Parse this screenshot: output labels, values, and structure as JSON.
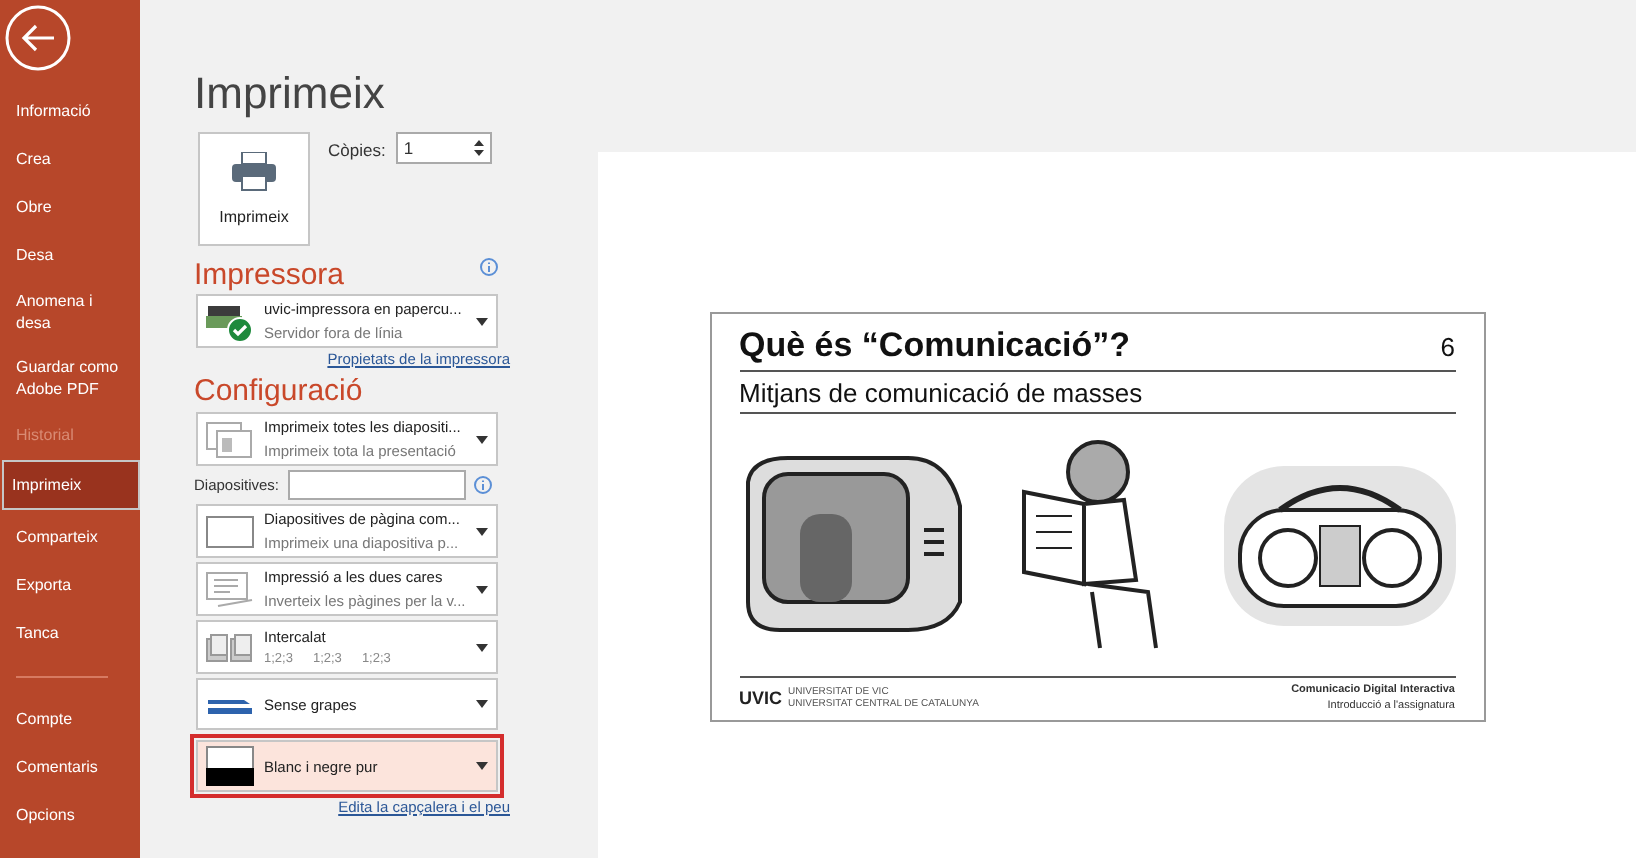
{
  "sidebar": {
    "items": [
      {
        "label": "Informació",
        "selected": false,
        "disabled": false
      },
      {
        "label": "Crea",
        "selected": false,
        "disabled": false
      },
      {
        "label": "Obre",
        "selected": false,
        "disabled": false
      },
      {
        "label": "Desa",
        "selected": false,
        "disabled": false
      },
      {
        "label": "Anomena i desa",
        "selected": false,
        "disabled": false
      },
      {
        "label": "Guardar como Adobe PDF",
        "selected": false,
        "disabled": false
      },
      {
        "label": "Historial",
        "selected": false,
        "disabled": true
      },
      {
        "label": "Imprimeix",
        "selected": true,
        "disabled": false
      },
      {
        "label": "Comparteix",
        "selected": false,
        "disabled": false
      },
      {
        "label": "Exporta",
        "selected": false,
        "disabled": false
      },
      {
        "label": "Tanca",
        "selected": false,
        "disabled": false
      }
    ],
    "footer_items": [
      {
        "label": "Compte"
      },
      {
        "label": "Comentaris"
      },
      {
        "label": "Opcions"
      }
    ]
  },
  "heading": "Imprimeix",
  "print_button": "Imprimeix",
  "copies": {
    "label": "Còpies:",
    "value": "1"
  },
  "printer": {
    "heading": "Impressora",
    "name": "uvic-impressora en papercu...",
    "status": "Servidor fora de línia",
    "link": "Propietats de la impressora"
  },
  "settings": {
    "heading": "Configuració",
    "items": [
      {
        "kind": "slides",
        "title": "Imprimeix totes les diapositi...",
        "subtitle": "Imprimeix tota la presentació",
        "highlighted": false
      },
      {
        "kind": "field",
        "label": "Diapositives:",
        "value": ""
      },
      {
        "kind": "layout",
        "title": "Diapositives de pàgina com...",
        "subtitle": "Imprimeix una diapositiva p...",
        "highlighted": false
      },
      {
        "kind": "duplex",
        "title": "Impressió a les dues cares",
        "subtitle": "Inverteix les pàgines per la v...",
        "highlighted": false
      },
      {
        "kind": "collate",
        "title": "Intercalat",
        "orders": [
          "1;2;3",
          "1;2;3",
          "1;2;3"
        ],
        "highlighted": false
      },
      {
        "kind": "staple",
        "title": "Sense grapes",
        "highlighted": false
      },
      {
        "kind": "color",
        "title": "Blanc i negre pur",
        "highlighted": true
      }
    ],
    "link": "Edita la capçalera i el peu"
  },
  "slide": {
    "title": "Què és “Comunicació”?",
    "number": "6",
    "subtitle": "Mitjans de comunicació de masses",
    "logo": "UVIC",
    "university_lines": [
      "UNIVERSITAT DE VIC",
      "UNIVERSITAT CENTRAL DE CATALUNYA"
    ],
    "course": "Comunicacio Digital Interactiva",
    "topic": "Introducció a l'assignatura"
  }
}
